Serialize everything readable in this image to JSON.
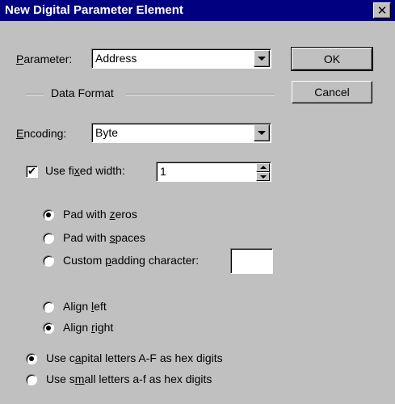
{
  "window": {
    "title": "New Digital Parameter Element",
    "close_glyph": "✕"
  },
  "parameter": {
    "label_accel": "P",
    "label_rest": "arameter:",
    "value": "Address"
  },
  "buttons": {
    "ok": "OK",
    "cancel": "Cancel"
  },
  "data_format": {
    "group_label": "Data Format"
  },
  "encoding": {
    "label_accel": "E",
    "label_rest": "ncoding:",
    "value": "Byte"
  },
  "fixed_width": {
    "checked": true,
    "check_glyph": "✔",
    "label_pre": "Use fi",
    "label_accel": "x",
    "label_post": "ed width:",
    "value": "1"
  },
  "padding": {
    "zeros": {
      "pre": "Pad with ",
      "accel": "z",
      "post": "eros",
      "checked": true
    },
    "spaces": {
      "pre": "Pad with ",
      "accel": "s",
      "post": "paces",
      "checked": false
    },
    "custom": {
      "pre": "Custom ",
      "accel": "p",
      "post": "adding character:",
      "checked": false,
      "value": ""
    }
  },
  "alignment": {
    "left": {
      "pre": "Align ",
      "accel": "l",
      "post": "eft",
      "checked": false
    },
    "right": {
      "pre": "Align ",
      "accel": "r",
      "post": "ight",
      "checked": true
    }
  },
  "hex_case": {
    "capital": {
      "pre": "Use c",
      "accel": "a",
      "post": "pital letters A-F as hex digits",
      "checked": true
    },
    "small": {
      "pre": "Use s",
      "accel": "m",
      "post": "all letters a-f as hex digits",
      "checked": false
    }
  },
  "colors": {
    "title_bar": "#000080",
    "dialog_face": "#c0c0c0"
  }
}
